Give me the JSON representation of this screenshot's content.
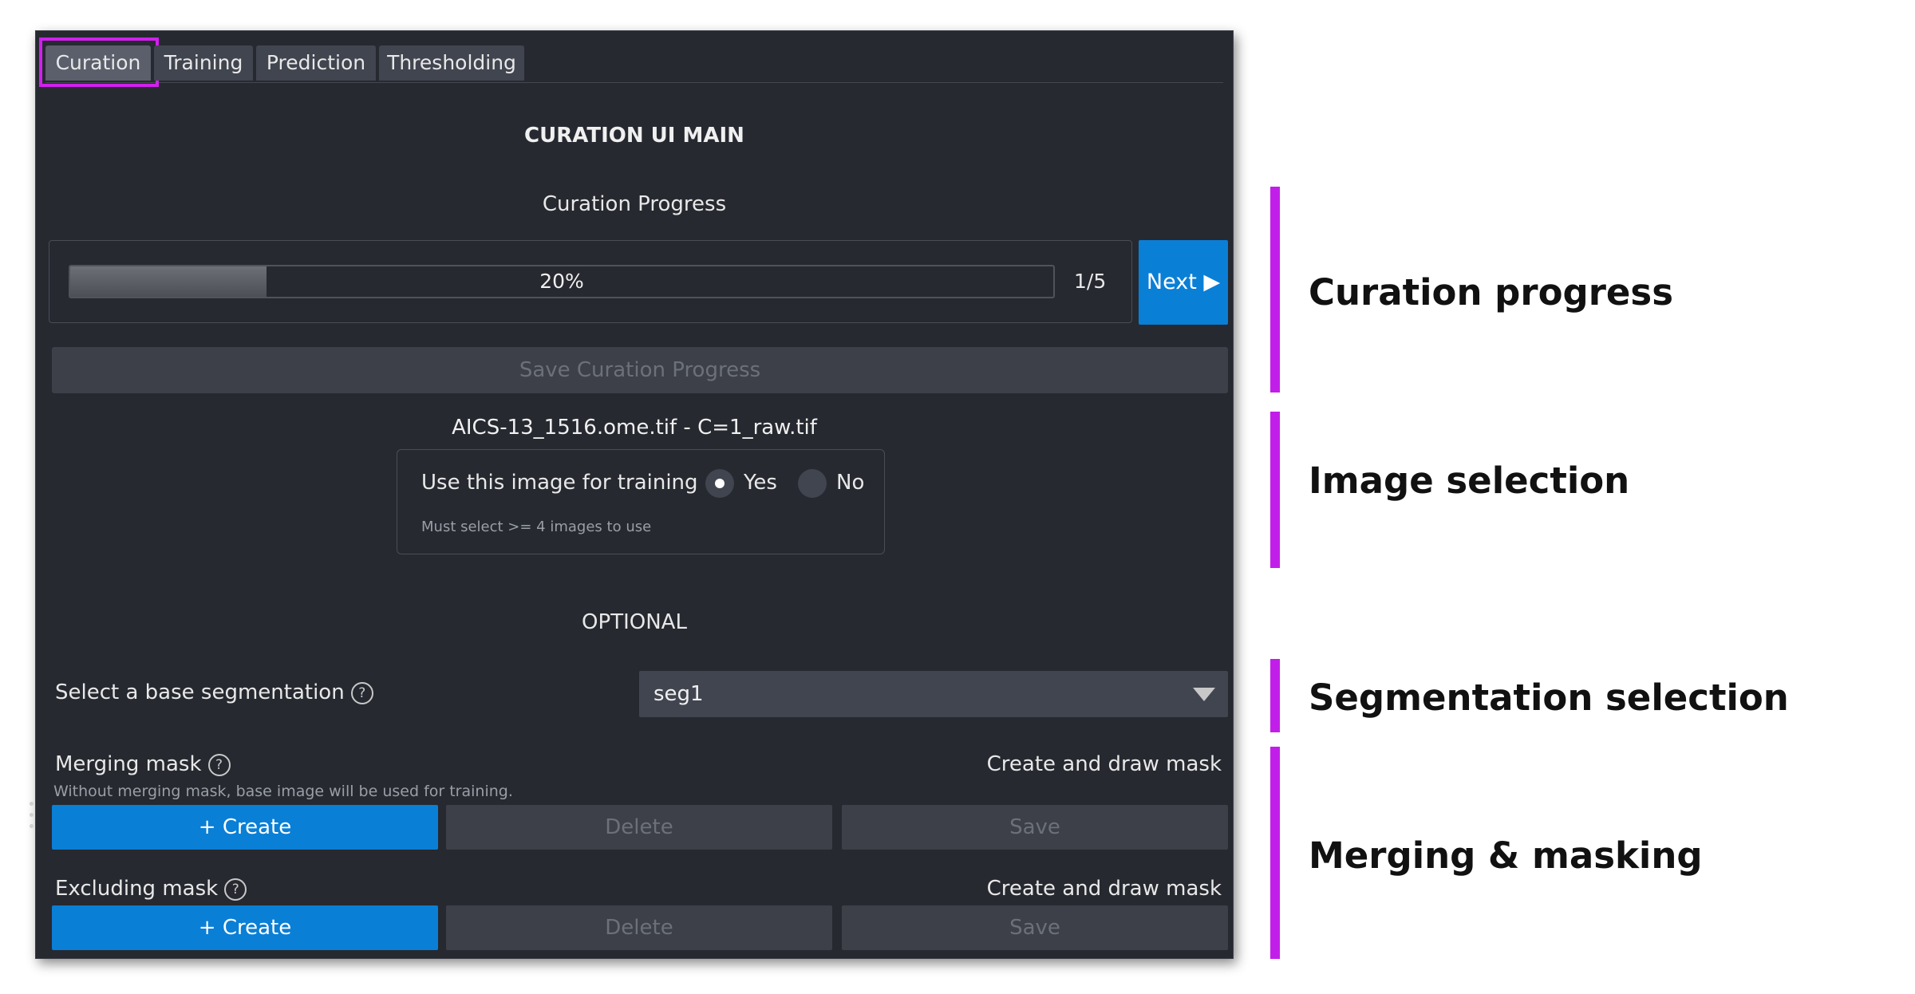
{
  "tabs": [
    {
      "label": "Curation",
      "active": true
    },
    {
      "label": "Training",
      "active": false
    },
    {
      "label": "Prediction",
      "active": false
    },
    {
      "label": "Thresholding",
      "active": false
    }
  ],
  "title": "CURATION UI MAIN",
  "progress": {
    "heading": "Curation Progress",
    "percent_label": "20%",
    "fraction": 0.2,
    "count": "1/5",
    "next_label": "Next ▶",
    "save_label": "Save Curation Progress"
  },
  "image": {
    "filename": "AICS-13_1516.ome.tif - C=1_raw.tif",
    "use_label": "Use this image for training",
    "yes_label": "Yes",
    "no_label": "No",
    "selected": "Yes",
    "hint": "Must select >= 4 images to use"
  },
  "optional_label": "OPTIONAL",
  "segmentation": {
    "label": "Select a base segmentation",
    "help_icon": "?",
    "value": "seg1"
  },
  "merging": {
    "label": "Merging mask",
    "help_icon": "?",
    "right_label": "Create and draw mask",
    "hint": "Without merging mask, base image will be used for training.",
    "create_label": "+ Create",
    "delete_label": "Delete",
    "save_label": "Save"
  },
  "excluding": {
    "label": "Excluding mask",
    "help_icon": "?",
    "right_label": "Create and draw mask",
    "create_label": "+ Create",
    "delete_label": "Delete",
    "save_label": "Save"
  },
  "annotations": [
    "Curation progress",
    "Image selection",
    "Segmentation selection",
    "Merging & masking"
  ],
  "colors": {
    "accent_blue": "#0a7fd6",
    "annotation_magenta": "#c21ee9",
    "panel_bg": "#262930"
  }
}
